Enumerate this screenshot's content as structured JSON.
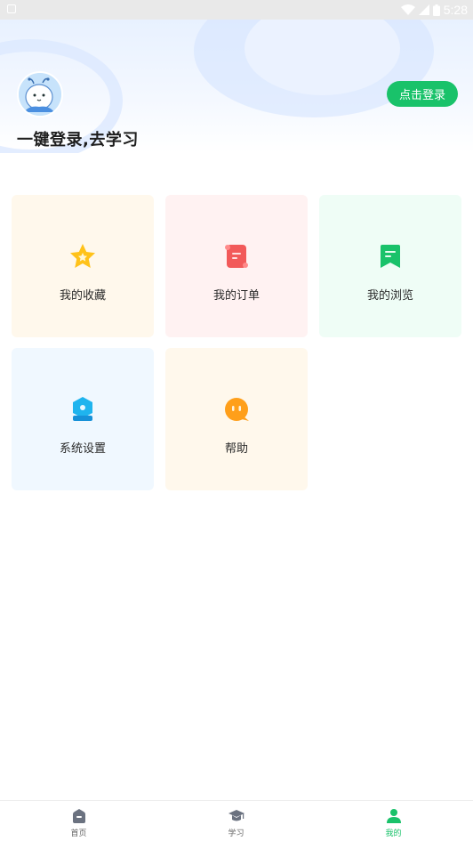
{
  "status_bar": {
    "time": "5:28"
  },
  "header": {
    "login_button": "点击登录",
    "title": "一键登录,去学习"
  },
  "menu": {
    "items": [
      {
        "label": "我的收藏",
        "icon": "star-icon",
        "bg": "#fff8ec"
      },
      {
        "label": "我的订单",
        "icon": "scroll-icon",
        "bg": "#fff2f2"
      },
      {
        "label": "我的浏览",
        "icon": "bookmark-icon",
        "bg": "#effdf6"
      },
      {
        "label": "系统设置",
        "icon": "settings-icon",
        "bg": "#f0f8ff"
      },
      {
        "label": "帮助",
        "icon": "chat-icon",
        "bg": "#fff8ec"
      }
    ]
  },
  "tabbar": {
    "tabs": [
      {
        "label": "首页",
        "icon": "home-icon"
      },
      {
        "label": "学习",
        "icon": "graduation-cap-icon"
      },
      {
        "label": "我的",
        "icon": "user-icon",
        "active": true
      }
    ]
  },
  "colors": {
    "accent": "#19c26a",
    "status_bar": "#e9e9e9"
  }
}
